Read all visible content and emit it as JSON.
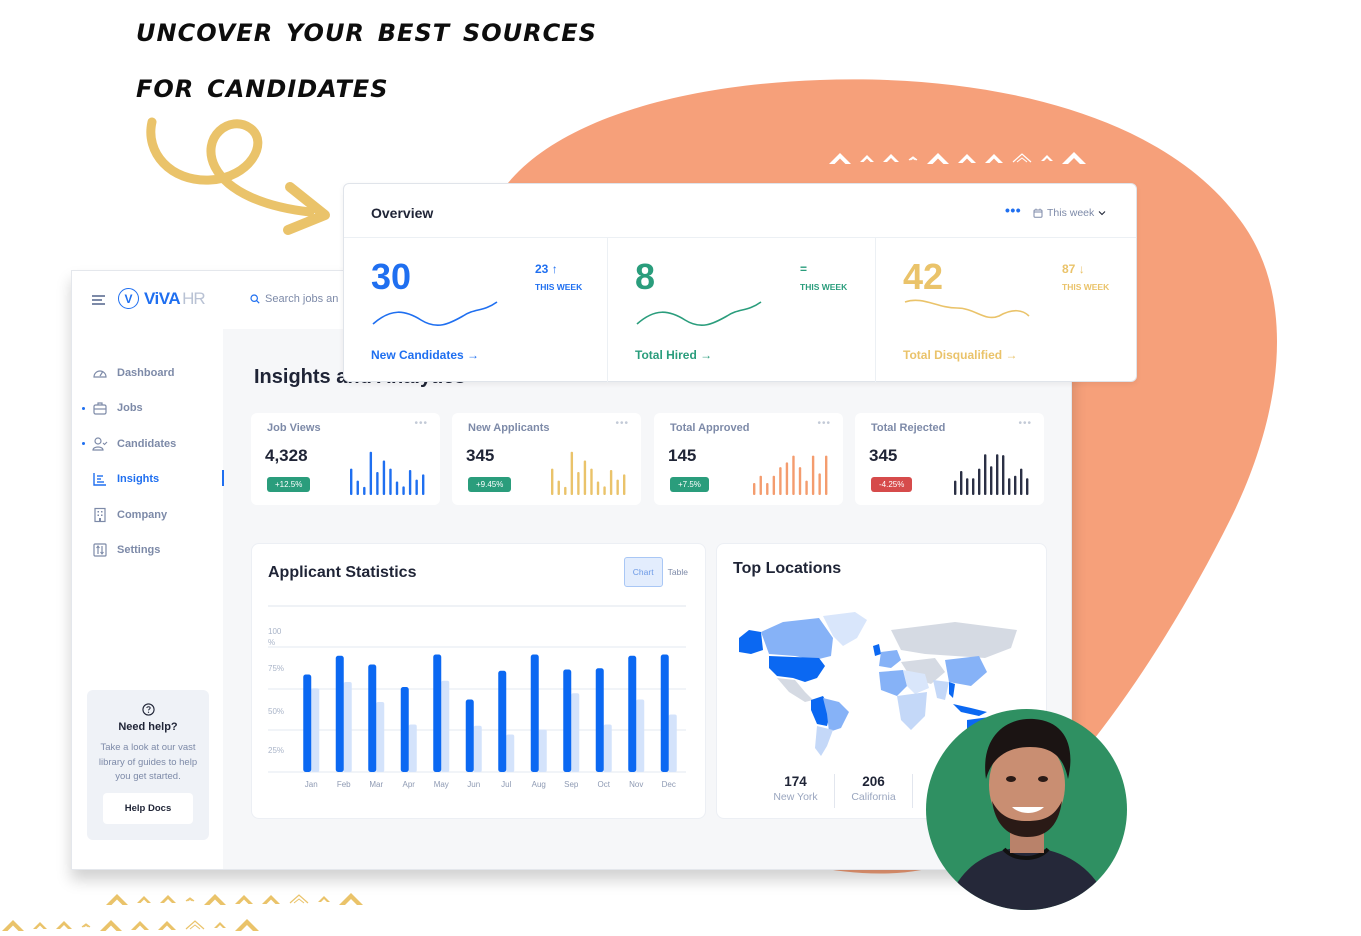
{
  "headline": {
    "line1": "Uncover your best sources",
    "line2": "for candidates"
  },
  "colors": {
    "blob": "#f6a07a",
    "accent_yellow": "#eac36a",
    "brand_blue": "#1f6ff0",
    "green": "#2a9d7c",
    "red": "#d64b4b",
    "dark": "#1f2436",
    "muted": "#7d8aa8",
    "orange": "#f49c6e",
    "avatar_bg": "#2f9062"
  },
  "app": {
    "logo_mark": "V",
    "logo_text": "ViVA",
    "logo_suffix": "HR",
    "search_placeholder": "Search jobs an",
    "menu_icon": "hamburger-icon"
  },
  "sidebar": {
    "items": [
      {
        "label": "Dashboard",
        "icon": "gauge-icon",
        "active": false,
        "dot": false
      },
      {
        "label": "Jobs",
        "icon": "briefcase-icon",
        "active": false,
        "dot": true
      },
      {
        "label": "Candidates",
        "icon": "user-check-icon",
        "active": false,
        "dot": true
      },
      {
        "label": "Insights",
        "icon": "bar-list-icon",
        "active": true,
        "dot": false
      },
      {
        "label": "Company",
        "icon": "building-icon",
        "active": false,
        "dot": false
      },
      {
        "label": "Settings",
        "icon": "sliders-icon",
        "active": false,
        "dot": false
      }
    ],
    "help": {
      "icon": "question-circle-icon",
      "title": "Need help?",
      "text": "Take a look at our vast library of guides to help you get started.",
      "button": "Help Docs"
    }
  },
  "main": {
    "title": "Insights and Analytics",
    "stat_cards": [
      {
        "label": "Job Views",
        "value": "4,328",
        "badge": "+12.5%",
        "badge_type": "up",
        "bar_color": "#1f6ff0",
        "bars": [
          0.55,
          0.3,
          0.17,
          0.9,
          0.48,
          0.72,
          0.55,
          0.28,
          0.18,
          0.52,
          0.32,
          0.43
        ]
      },
      {
        "label": "New Applicants",
        "value": "345",
        "badge": "+9.45%",
        "badge_type": "up",
        "bar_color": "#eac36a",
        "bars": [
          0.55,
          0.3,
          0.17,
          0.9,
          0.48,
          0.72,
          0.55,
          0.28,
          0.18,
          0.52,
          0.32,
          0.43
        ]
      },
      {
        "label": "Total Approved",
        "value": "145",
        "badge": "+7.5%",
        "badge_type": "up",
        "bar_color": "#f49c6e",
        "bars": [
          0.25,
          0.4,
          0.25,
          0.4,
          0.58,
          0.68,
          0.82,
          0.58,
          0.3,
          0.82,
          0.45,
          0.82
        ]
      },
      {
        "label": "Total Rejected",
        "value": "345",
        "badge": "-4.25%",
        "badge_type": "down",
        "bar_color": "#2b3045",
        "bars": [
          0.3,
          0.5,
          0.35,
          0.35,
          0.55,
          0.85,
          0.6,
          0.85,
          0.83,
          0.35,
          0.4,
          0.55,
          0.35
        ]
      }
    ],
    "applicant_stats": {
      "title": "Applicant Statistics",
      "toggle": [
        {
          "label": "Chart",
          "selected": true
        },
        {
          "label": "Table",
          "selected": false
        }
      ]
    },
    "top_locations": {
      "title": "Top Locations",
      "stats": [
        {
          "value": "174",
          "label": "New York"
        },
        {
          "value": "206",
          "label": "California"
        }
      ]
    }
  },
  "overview": {
    "title": "Overview",
    "more_icon": "more-horizontal-icon",
    "period": "This week",
    "cells": [
      {
        "value": "30",
        "delta": "23",
        "trend": "up",
        "trend_glyph": "↑",
        "sub": "THIS WEEK",
        "link": "New Candidates →",
        "color": "#1f6ff0"
      },
      {
        "value": "8",
        "delta": "=",
        "trend": "flat",
        "trend_glyph": "",
        "sub": "THIS WEEK",
        "link": "Total Hired →",
        "color": "#2a9d7c"
      },
      {
        "value": "42",
        "delta": "87",
        "trend": "down",
        "trend_glyph": "↓",
        "sub": "THIS WEEK",
        "link": "Total Disqualified →",
        "color": "#eac36a"
      }
    ]
  },
  "chart_data": {
    "type": "bar",
    "title": "Applicant Statistics",
    "xlabel": "",
    "ylabel": "",
    "categories": [
      "Jan",
      "Feb",
      "Mar",
      "Apr",
      "May",
      "Jun",
      "Jul",
      "Aug",
      "Sep",
      "Oct",
      "Nov",
      "Dec"
    ],
    "series": [
      {
        "name": "primary",
        "color": "#0b68f2",
        "values": [
          78,
          93,
          86,
          68,
          94,
          58,
          81,
          94,
          82,
          83,
          93,
          94
        ]
      },
      {
        "name": "secondary",
        "color": "#d4e3fb",
        "values": [
          67,
          72,
          56,
          38,
          73,
          37,
          30,
          34,
          63,
          38,
          58,
          46
        ]
      }
    ],
    "y_tick_labels": [
      "100 %",
      "75%",
      "50%",
      "25%"
    ],
    "ylim": [
      0,
      100
    ],
    "grid": true,
    "legend": "none"
  },
  "map": {
    "type": "choropleth",
    "highlighted_dark": [
      "United States",
      "Alaska",
      "United Kingdom",
      "Peru",
      "Bolivia",
      "Australia",
      "Indonesia",
      "Myanmar"
    ],
    "highlighted_medium": [
      "Canada",
      "Brazil",
      "China",
      "West Africa",
      "Western Europe"
    ],
    "highlighted_light": [
      "Greenland",
      "Argentina",
      "Southern Africa",
      "North Africa",
      "India"
    ]
  }
}
